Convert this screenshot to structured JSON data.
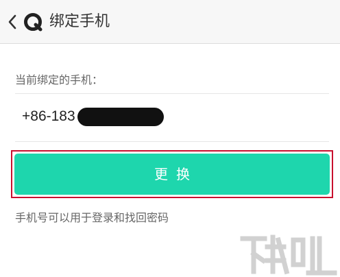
{
  "header": {
    "title": "绑定手机",
    "back_icon": "chevron-left-icon",
    "logo_icon": "app-logo-icon"
  },
  "main": {
    "section_label": "当前绑定的手机：",
    "phone_visible": "+86-183",
    "button_label": "更换",
    "hint": "手机号可以用于登录和找回密码"
  },
  "colors": {
    "accent": "#1ed6ad",
    "highlight_border": "#c8102e",
    "header_bg": "#f7f7f7"
  }
}
